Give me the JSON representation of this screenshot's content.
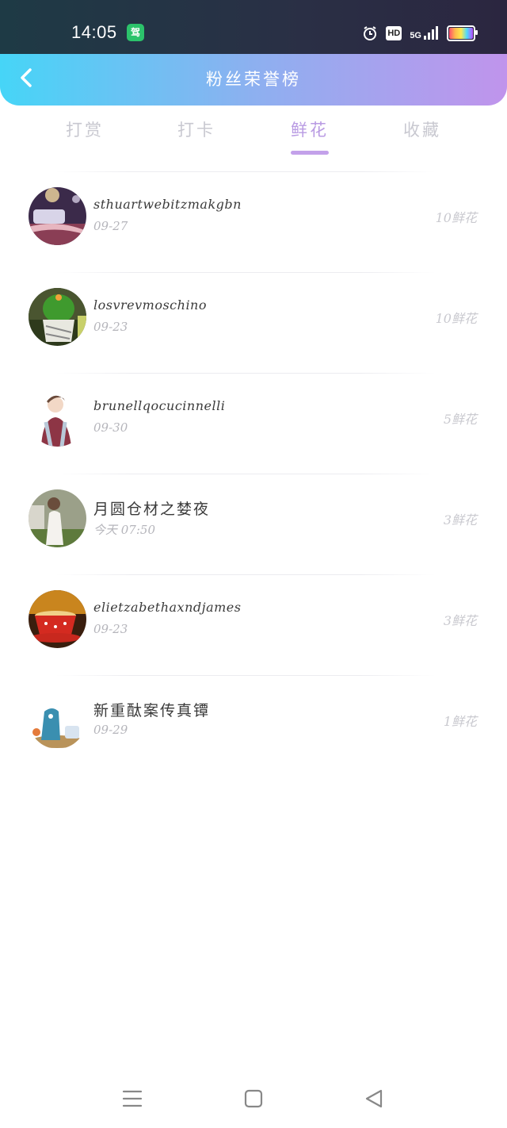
{
  "status_bar": {
    "time": "14:05",
    "app_icon_text": "驾",
    "hd_label": "HD",
    "signal_label": "5G",
    "icons": [
      "alarm-icon",
      "hd-icon",
      "signal-icon",
      "battery-icon"
    ]
  },
  "header": {
    "title": "粉丝荣誉榜",
    "back_icon": "chevron-left-icon"
  },
  "tabs": [
    {
      "label": "打赏",
      "active": false
    },
    {
      "label": "打卡",
      "active": false
    },
    {
      "label": "鲜花",
      "active": true
    },
    {
      "label": "收藏",
      "active": false
    }
  ],
  "list": [
    {
      "name": "sthuartwebitzmakgbn",
      "date": "09-27",
      "count": "10鲜花"
    },
    {
      "name": "losvrevmoschino",
      "date": "09-23",
      "count": "10鲜花"
    },
    {
      "name": "brunellqocucinnelli",
      "date": "09-30",
      "count": "5鲜花"
    },
    {
      "name": "月圆仓材之婪夜",
      "date": "今天 07:50",
      "count": "3鲜花"
    },
    {
      "name": "elietzabethaxndjames",
      "date": "09-23",
      "count": "3鲜花"
    },
    {
      "name": "新重酞案传真镡",
      "date": "09-29",
      "count": "1鲜花"
    }
  ],
  "nav_bar": {
    "icons": [
      "menu-icon",
      "home-square-icon",
      "back-triangle-icon"
    ]
  },
  "colors": {
    "header_start": "#46d5f7",
    "header_end": "#c094ec",
    "active_tab": "#b99be3"
  }
}
